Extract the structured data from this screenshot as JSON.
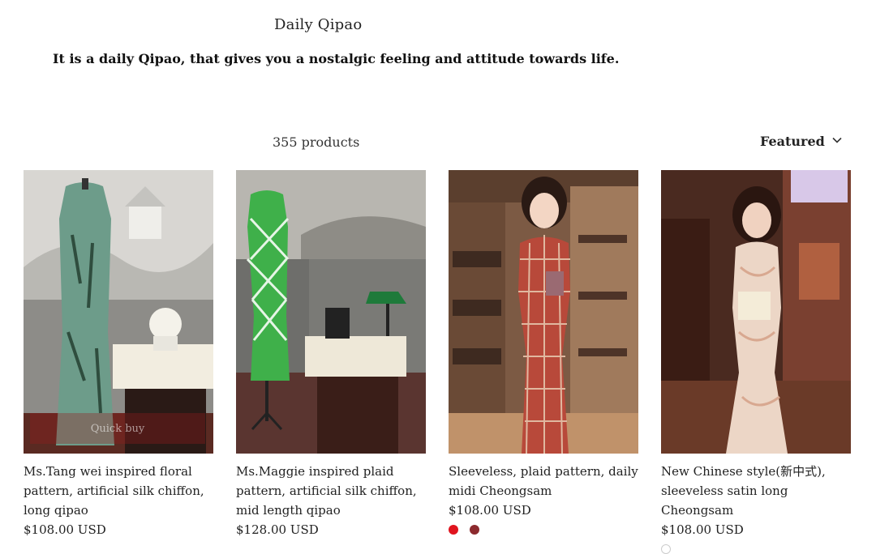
{
  "collection": {
    "title": "Daily Qipao",
    "description": "It is a daily Qipao, that gives you a nostalgic feeling and attitude towards life."
  },
  "toolbar": {
    "product_count": "355 products",
    "sort_label": "Featured",
    "sort_icon": "chevron-down-icon"
  },
  "products": [
    {
      "title": "Ms.Tang wei inspired floral pattern, artificial silk chiffon, long qipao",
      "price": "$108.00 USD",
      "quick_buy": "Quick buy"
    },
    {
      "title": "Ms.Maggie inspired plaid pattern, artificial silk chiffon, mid length qipao",
      "price": "$128.00 USD"
    },
    {
      "title": "Sleeveless, plaid pattern, daily midi Cheongsam",
      "price": "$108.00 USD",
      "swatches": [
        "#e0141e",
        "#8c2a2e"
      ]
    },
    {
      "title": "New Chinese style(新中式), sleeveless satin long Cheongsam",
      "price": "$108.00 USD",
      "swatches": [
        "#ffffff"
      ]
    }
  ]
}
